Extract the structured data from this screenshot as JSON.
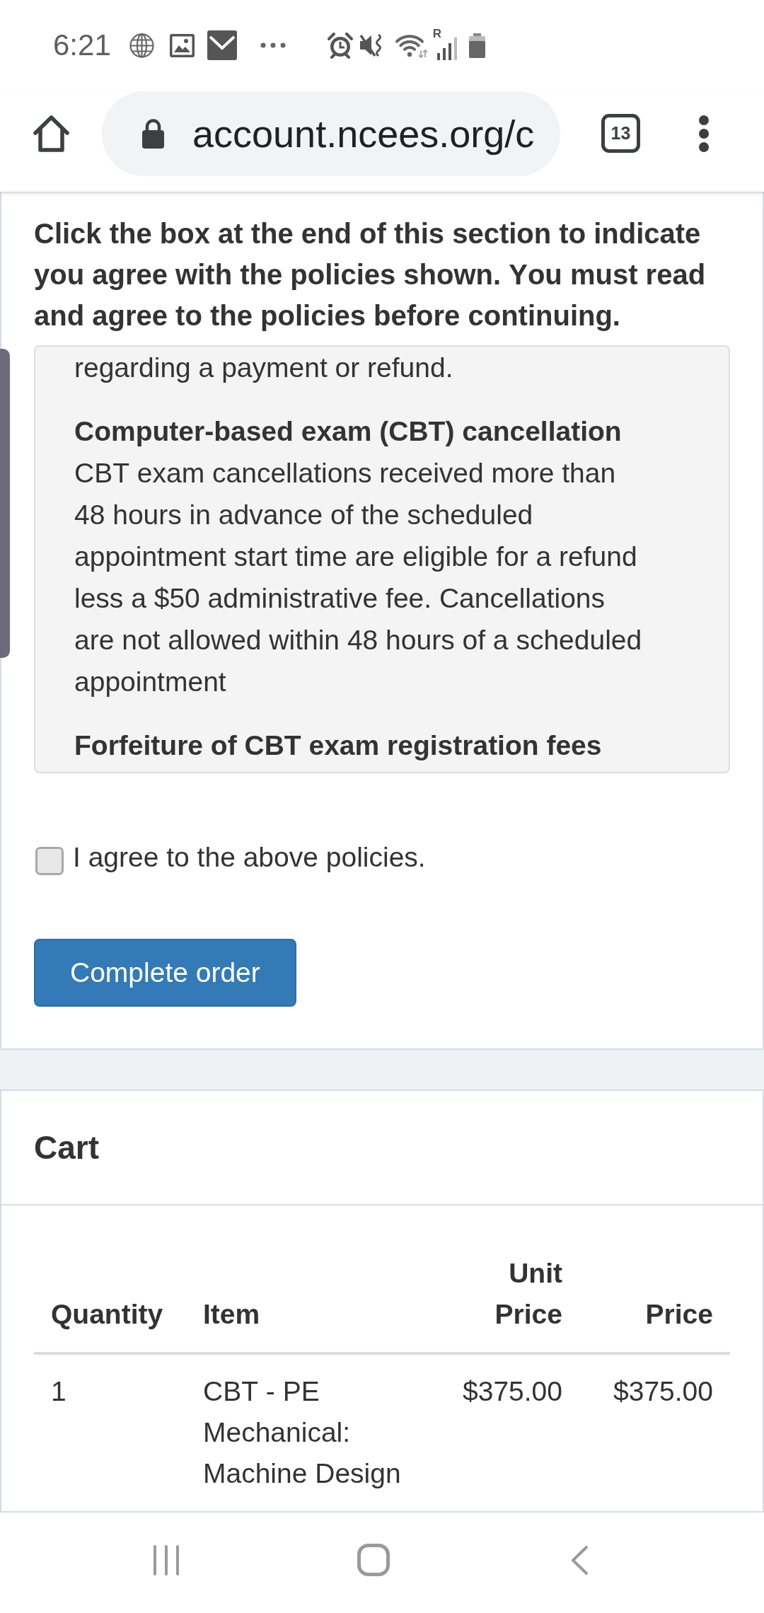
{
  "status_bar": {
    "time": "6:21",
    "network_indicator": "R"
  },
  "browser": {
    "url": "account.ncees.org/c",
    "tab_count": "13"
  },
  "policy_section": {
    "instructions": "Click the box at the end of this section to indicate you agree with the policies shown. You must read and agree to the policies before continuing.",
    "policies": [
      {
        "kind": "text",
        "text": "regarding a payment or refund."
      },
      {
        "kind": "heading",
        "text": "Computer-based exam (CBT) cancellation"
      },
      {
        "kind": "text",
        "text": "CBT exam cancellations received more than 48 hours in advance of the scheduled appointment start time are eligible for a refund less a $50 administrative fee. Cancellations are not allowed within 48 hours of a scheduled appointment"
      },
      {
        "kind": "heading",
        "text": "Forfeiture of CBT exam registration fees"
      }
    ],
    "agreement": {
      "label": "I agree to the above policies.",
      "checked": false
    },
    "submit_button": "Complete order"
  },
  "cart": {
    "title": "Cart",
    "columns": [
      {
        "label": "Quantity",
        "kind": "text"
      },
      {
        "label": "Item",
        "kind": "text"
      },
      {
        "label": "Unit Price",
        "kind": "amount"
      },
      {
        "label": "Price",
        "kind": "amount"
      }
    ],
    "rows": [
      {
        "cells": [
          "1",
          "CBT - PE Mechanical: Machine Design",
          "$375.00",
          "$375.00"
        ]
      }
    ]
  }
}
